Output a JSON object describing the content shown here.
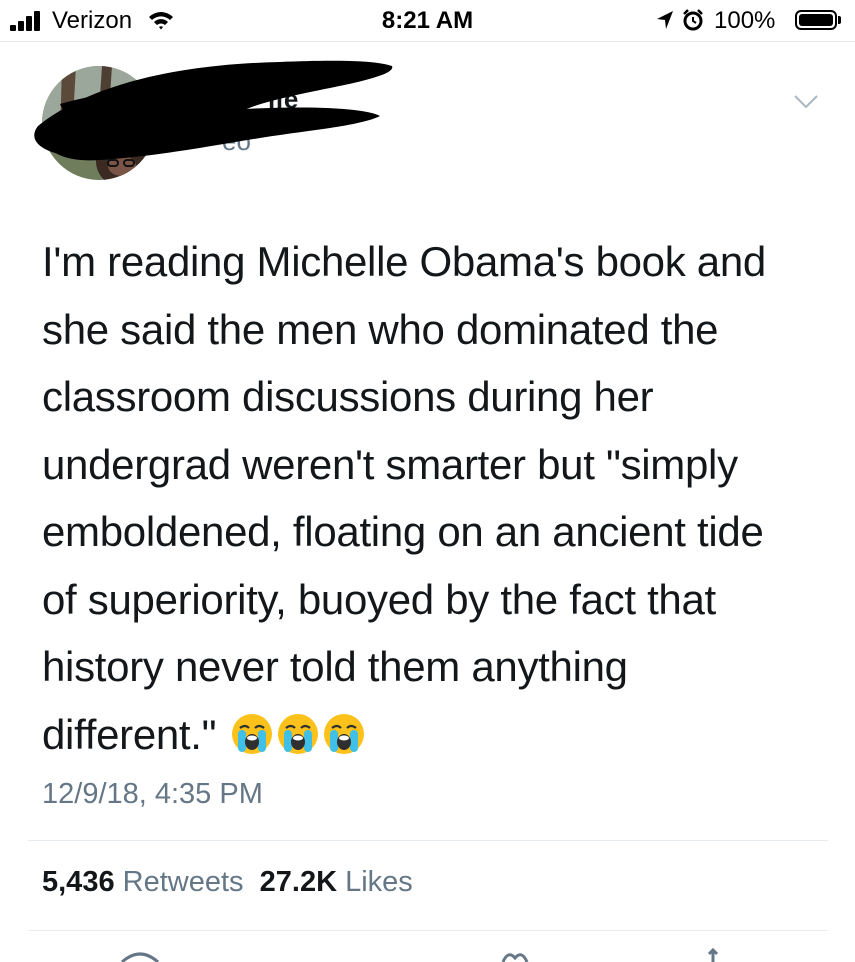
{
  "status_bar": {
    "carrier": "Verizon",
    "time": "8:21 AM",
    "battery_percent": "100%",
    "icons": [
      "signal-icon",
      "wifi-icon",
      "location-arrow-icon",
      "alarm-icon",
      "battery-icon"
    ]
  },
  "tweet": {
    "author_name_fragment": "ife",
    "handle_fragment": "eo",
    "text": "I'm reading Michelle Obama's book and\nshe said the men who dominated the\nclassroom discussions during her\nundergrad weren't smarter but \"simply\nemboldened, floating on an ancient tide\nof superiority, buoyed by the fact that\nhistory never told them anything\ndifferent.\"",
    "emojis": [
      "loudly-crying-face",
      "loudly-crying-face",
      "loudly-crying-face"
    ],
    "timestamp": "12/9/18, 4:35 PM",
    "retweets_count": "5,436",
    "retweets_label": "Retweets",
    "likes_count": "27.2K",
    "likes_label": "Likes"
  },
  "colors": {
    "text": "#14171a",
    "secondary": "#657786",
    "divider": "#e6ecf0"
  }
}
